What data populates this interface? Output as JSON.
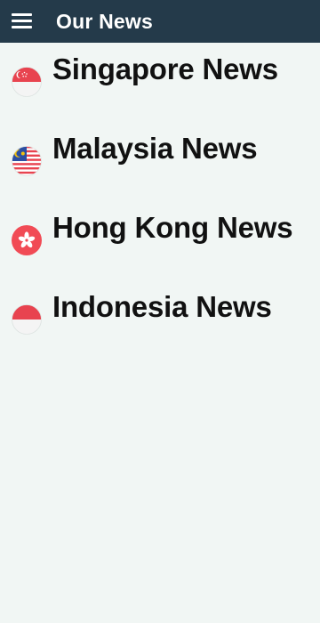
{
  "app_bar": {
    "title": "Our News",
    "menu_icon": "hamburger-menu-icon",
    "background": "#243a4a"
  },
  "news_items": [
    {
      "label": "Singapore News",
      "flag_icon": "singapore-flag-icon"
    },
    {
      "label": "Malaysia News",
      "flag_icon": "malaysia-flag-icon"
    },
    {
      "label": "Hong Kong News",
      "flag_icon": "hong-kong-flag-icon"
    },
    {
      "label": "Indonesia News",
      "flag_icon": "indonesia-flag-icon"
    }
  ],
  "colors": {
    "background": "#f1f6f4",
    "flag_red": "#e8434f",
    "flag_white": "#ffffff",
    "flag_blue": "#2b4ea2",
    "flag_yellow": "#f4c20d"
  }
}
